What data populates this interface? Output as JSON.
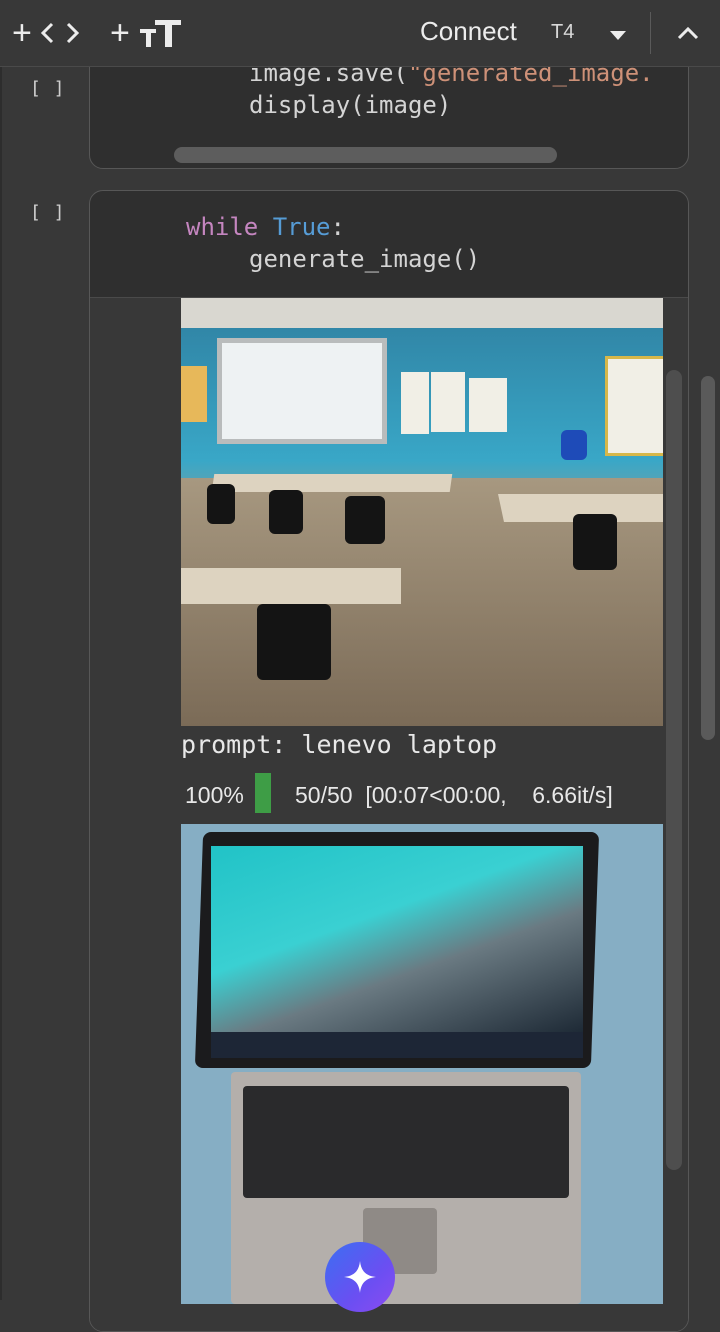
{
  "toolbar": {
    "add_code_icon": "plus-code-icon",
    "add_text_icon": "plus-text-icon",
    "connect_label": "Connect",
    "runtime_label": "T4",
    "dropdown_icon": "caret-down-icon",
    "collapse_icon": "chevron-up-icon"
  },
  "cells": [
    {
      "bracket": "[ ]",
      "code_lines": [
        "image.save(",
        "\"generated_image.",
        "display(image)"
      ]
    },
    {
      "bracket": "[ ]",
      "code_keyword": "while",
      "code_constant": "True",
      "code_colon": ":",
      "code_line2": "generate_image()"
    }
  ],
  "output": {
    "prompt_text": "prompt: lenevo laptop",
    "progress_percent_label": "100%",
    "progress_fraction": 1.0,
    "progress_count": "50/50  [00:07<00:00,    6.66it/s]"
  },
  "colors": {
    "string": "#ce9178",
    "keyword": "#c586c0",
    "constant": "#569cd6",
    "progress": "#3e9d46"
  },
  "fab_icon": "gemini-sparkle-icon"
}
